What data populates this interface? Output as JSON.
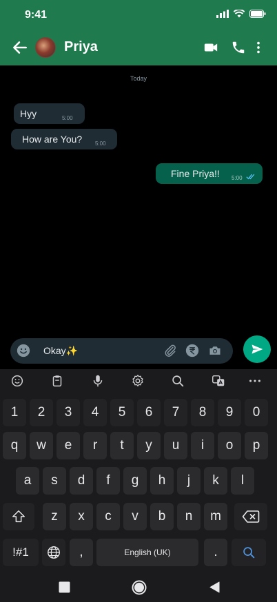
{
  "status_bar": {
    "time": "9:41"
  },
  "header": {
    "contact_name": "Priya"
  },
  "chat": {
    "date_label": "Today",
    "messages": [
      {
        "text": "Hyy",
        "time": "5:00",
        "direction": "incoming"
      },
      {
        "text": "How are You?",
        "time": "5:00",
        "direction": "incoming"
      },
      {
        "text": "Fine Priya!!",
        "time": "5:00",
        "direction": "outgoing",
        "status": "read"
      }
    ]
  },
  "composer": {
    "value": "Okay✨"
  },
  "keyboard": {
    "number_row": [
      "1",
      "2",
      "3",
      "4",
      "5",
      "6",
      "7",
      "8",
      "9",
      "0"
    ],
    "row1": [
      "q",
      "w",
      "e",
      "r",
      "t",
      "y",
      "u",
      "i",
      "o",
      "p"
    ],
    "row2": [
      "a",
      "s",
      "d",
      "f",
      "g",
      "h",
      "j",
      "k",
      "l"
    ],
    "row3": [
      "z",
      "x",
      "c",
      "v",
      "b",
      "n",
      "m"
    ],
    "symbols_label": "!#1",
    "comma_label": ",",
    "space_label": "English (UK)",
    "period_label": "."
  },
  "colors": {
    "header_bg": "#1f7a4d",
    "incoming_bubble": "#1f2c34",
    "outgoing_bubble": "#06614c",
    "send_button": "#00a884",
    "read_ticks": "#53bdeb"
  },
  "icons": {
    "status": [
      "signal-icon",
      "wifi-icon",
      "battery-icon"
    ],
    "header": [
      "back-arrow-icon",
      "video-call-icon",
      "phone-icon",
      "more-vertical-icon"
    ],
    "composer": [
      "emoji-icon",
      "attach-icon",
      "rupee-icon",
      "camera-icon",
      "send-icon"
    ],
    "keyboard_tools": [
      "emoji-icon",
      "clipboard-icon",
      "mic-icon",
      "settings-icon",
      "search-icon",
      "translate-icon",
      "more-horizontal-icon"
    ]
  }
}
